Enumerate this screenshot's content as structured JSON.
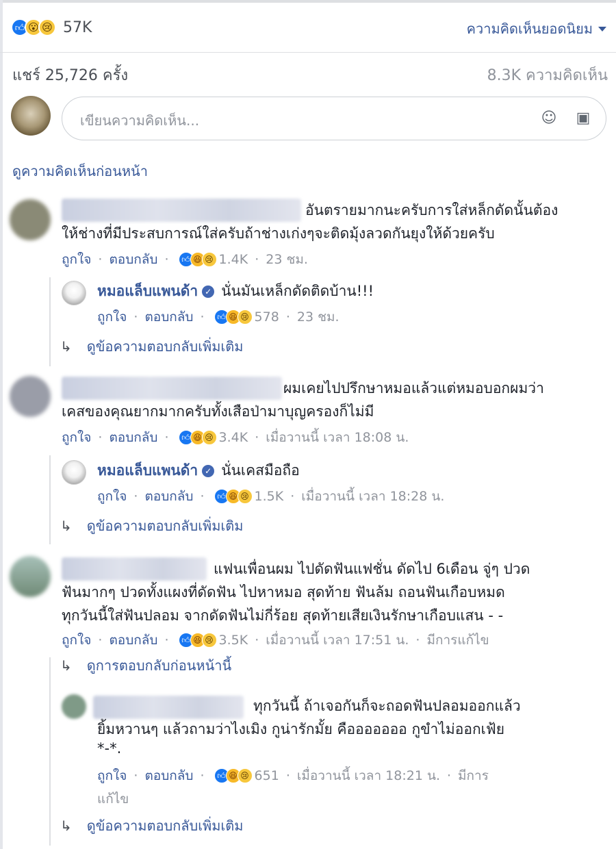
{
  "summary": {
    "reaction_count": "57K",
    "sort_label": "ความคิดเห็นยอดนิยม",
    "shares": "แชร์ 25,726 ครั้ง",
    "comments_count": "8.3K ความคิดเห็น"
  },
  "composer": {
    "placeholder": "เขียนความคิดเห็น..."
  },
  "view_previous": "ดูความคิดเห็นก่อนหน้า",
  "actions": {
    "like": "ถูกใจ",
    "reply": "ตอบกลับ",
    "edited": "มีการแก้ไข"
  },
  "comments": [
    {
      "text": "อันตรายมากนะครับการใส่หล็กดัดนั้นต้อง ให้ช่างที่มีประสบการณ์ใส่ครับถ้าช่างเก่งๆจะติดมุ้งลวดกันยุงให้ด้วยครับ",
      "line1": "อันตรายมากนะครับการใส่หล็กดัดนั้นต้อง",
      "line2": "ให้ช่างที่มีประสบการณ์ใส่ครับถ้าช่างเก่งๆจะติดมุ้งลวดกันยุงให้ด้วยครับ",
      "reactions": "1.4K",
      "time": "23 ชม.",
      "reply": {
        "name": "หมอแล็บแพนด้า",
        "text": "นั่นมันเหล็กดัดติดบ้าน!!!",
        "reactions": "578",
        "time": "23 ชม."
      },
      "more_replies": "ดูข้อความตอบกลับเพิ่มเติม"
    },
    {
      "line1": "ผมเคยไปปรึกษาหมอแล้วแต่หมอบอกผมว่า",
      "line2": "เคสของคุณยากมากครับทั้งเสือป่ามาบุญครองก็ไม่มี",
      "reactions": "3.4K",
      "time": "เมื่อวานนี้ เวลา 18:08 น.",
      "reply": {
        "name": "หมอแล็บแพนด้า",
        "text": "นั่นเคสมือถือ",
        "reactions": "1.5K",
        "time": "เมื่อวานนี้ เวลา 18:28 น."
      },
      "more_replies": "ดูข้อความตอบกลับเพิ่มเติม"
    },
    {
      "line1": "แฟนเพื่อนผม ไปดัดฟันแฟชั่น ดัดไป 6เดือน จู่ๆ ปวด",
      "line2": "ฟันมากๆ ปวดทั้งแผงที่ดัดฟัน ไปหาหมอ สุดท้าย ฟันล้ม ถอนฟันเกือบหมด",
      "line3": "ทุกวันนี้ใส่ฟันปลอม จากดัดฟันไม่กี่ร้อย สุดท้ายเสียเงินรักษาเกือบแสน - -",
      "reactions": "3.5K",
      "time": "เมื่อวานนี้ เวลา 17:51 น.",
      "prev_replies": "ดูการตอบกลับก่อนหน้านี้",
      "reply": {
        "line1": "ทุกวันนี้ ถ้าเจอกันก็จะถอดฟันปลอมออกแล้ว",
        "line2": "ยิ้มหวานๆ แล้วถามว่าไงเมิง กูน่ารักมั้ย คือออออออ กูขำไม่ออกเฟ้ย",
        "line3": "*-*.",
        "reactions": "651",
        "time": "เมื่อวานนี้ เวลา 18:21 น.",
        "edited_a": "มีการ",
        "edited_b": "แก้ไข"
      },
      "more_replies": "ดูข้อความตอบกลับเพิ่มเติม"
    }
  ]
}
